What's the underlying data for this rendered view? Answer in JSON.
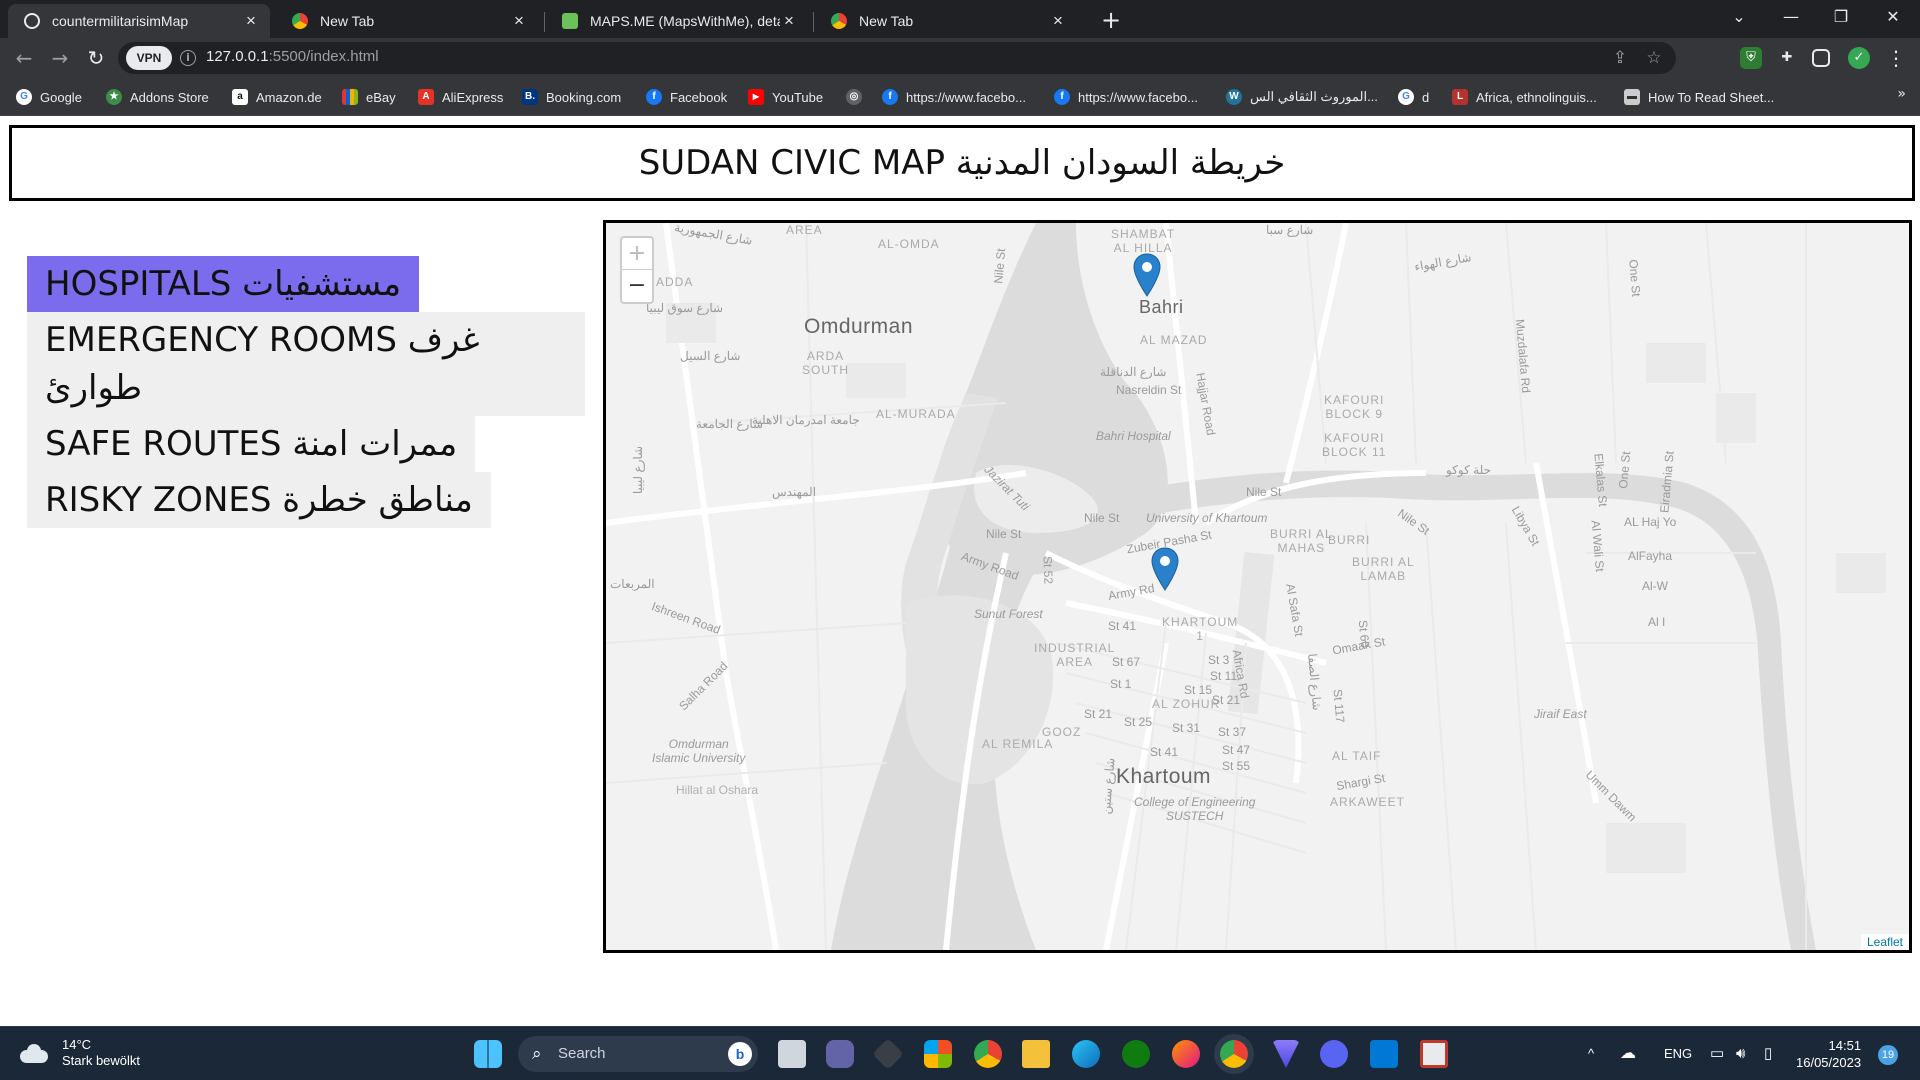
{
  "browser": {
    "tabs": [
      {
        "title": "countermilitarisimMap",
        "icon": "globe-icon",
        "color": "#e8eaed"
      },
      {
        "title": "New Tab",
        "icon": "chrome-icon",
        "color": "#4285f4"
      },
      {
        "title": "MAPS.ME (MapsWithMe), detailed",
        "icon": "mapsme-icon",
        "color": "#6ac259"
      },
      {
        "title": "New Tab",
        "icon": "chrome-icon",
        "color": "#4285f4"
      }
    ],
    "new_tab_label": "+",
    "vpn_label": "VPN",
    "url_host": "127.0.0.1",
    "url_path": ":5500/index.html",
    "bookmarks": [
      {
        "label": "Google",
        "icon": "google-icon",
        "color": "#4285f4",
        "glyph": "G"
      },
      {
        "label": "Addons Store",
        "icon": "addons-icon",
        "color": "#3c8c4a",
        "glyph": "★"
      },
      {
        "label": "Amazon.de",
        "icon": "amazon-icon",
        "color": "#111111",
        "glyph": "a"
      },
      {
        "label": "eBay",
        "icon": "ebay-icon",
        "color": "#e53238",
        "glyph": "e"
      },
      {
        "label": "AliExpress",
        "icon": "aliexpress-icon",
        "color": "#e43225",
        "glyph": "A"
      },
      {
        "label": "Booking.com",
        "icon": "booking-icon",
        "color": "#003580",
        "glyph": "B."
      },
      {
        "label": "Facebook",
        "icon": "facebook-icon",
        "color": "#1877f2",
        "glyph": "f"
      },
      {
        "label": "YouTube",
        "icon": "youtube-icon",
        "color": "#ff0000",
        "glyph": "▶"
      },
      {
        "label": "",
        "icon": "globe-icon",
        "color": "#5f6368",
        "glyph": "◎"
      },
      {
        "label": "https://www.facebo...",
        "icon": "facebook-icon",
        "color": "#1877f2",
        "glyph": "f"
      },
      {
        "label": "https://www.facebo...",
        "icon": "facebook-icon",
        "color": "#1877f2",
        "glyph": "f"
      },
      {
        "label": "الموروث الثقافي الس...",
        "icon": "wordpress-icon",
        "color": "#21759b",
        "glyph": "W"
      },
      {
        "label": "d",
        "icon": "google-icon",
        "color": "#4285f4",
        "glyph": "G"
      },
      {
        "label": "Africa, ethnolinguis...",
        "icon": "loc-icon",
        "color": "#b5332e",
        "glyph": "L"
      },
      {
        "label": "How To Read Sheet...",
        "icon": "sheet-icon",
        "color": "#cccccc",
        "glyph": "▬"
      }
    ],
    "more_label": "»"
  },
  "page": {
    "title": "SUDAN CIVIC MAP خريطة السودان المدنية",
    "categories": [
      {
        "label": "HOSPITALS مستشفيات",
        "active": true
      },
      {
        "label": "EMERGENCY ROOMS غرف طوارئ",
        "active": false
      },
      {
        "label": "SAFE ROUTES ممرات امنة",
        "active": false
      },
      {
        "label": "RISKY ZONES مناطق خطرة",
        "active": false
      }
    ],
    "active_color": "#7b6cee",
    "marker_color": "#2a81cb"
  },
  "map": {
    "zoom_in": "+",
    "zoom_out": "−",
    "attribution": "Leaflet",
    "labels": {
      "omdurman": "Omdurman",
      "bahri": "Bahri",
      "khartoum": "Khartoum",
      "area": "AREA",
      "al_omda": "AL-OMDA",
      "shambat": "SHAMBAT",
      "al_hilla": "AL HILLA",
      "adda": "ADDA",
      "arda": "ARDA",
      "south": "SOUTH",
      "al_mazad": "AL MAZAD",
      "al_murada": "AL-MURADA",
      "kafouri9a": "KAFOURI",
      "kafouri9b": "BLOCK 9",
      "kafouri11a": "KAFOURI",
      "kafouri11b": "BLOCK 11",
      "burri_mahas_a": "BURRI AL",
      "burri_mahas_b": "MAHAS",
      "burri": "BURRI",
      "burri_lamab_a": "BURRI AL",
      "burri_lamab_b": "LAMAB",
      "khartoum1_a": "KHARTOUM",
      "khartoum1_b": "1",
      "industrial_a": "INDUSTRIAL",
      "industrial_b": "AREA",
      "al_zohur": "AL ZOHUR",
      "al_remila": "AL REMILA",
      "gooz": "GOOZ",
      "al_taif": "AL TAIF",
      "arkaweet": "ARKAWEET",
      "nasreldin": "Nasreldin St",
      "bahri_hospital": "Bahri Hospital",
      "hajjar": "Hajjar Road",
      "muzdalafa": "Muzdalafa Rd",
      "nile1": "Nile St",
      "nile2": "Nile St",
      "nile3": "Nile St",
      "nile4": "Nile St",
      "nile5": "Nile St",
      "jazirat": "Jazirat Tuti",
      "uofk": "University of Khartoum",
      "zubeir": "Zubeir Pasha St",
      "army1": "Army Road",
      "army2": "Army Rd",
      "st52": "St 52",
      "sunut": "Sunut Forest",
      "ishreen": "Ishreen Road",
      "salha": "Salha Road",
      "omdurman_islamic_a": "Omdurman",
      "omdurman_islamic_b": "Islamic University",
      "hillat": "Hillat al Oshara",
      "college_a": "College of Engineering",
      "college_b": "SUSTECH",
      "st41a": "St 41",
      "st67": "St 67",
      "st1": "St 1",
      "st3": "St 3",
      "st11": "St 11",
      "st15": "St 15",
      "st21a": "St 21",
      "st21b": "St 21",
      "st25": "St 25",
      "st31": "St 31",
      "st37": "St 37",
      "st41b": "St 41",
      "st47": "St 47",
      "st55": "St 55",
      "africa": "Africa Rd",
      "alsafa": "Al Safa St",
      "st60": "St 60",
      "st117": "St 117",
      "omaak": "Omaak St",
      "shargi": "Shargi St",
      "libya": "Libya St",
      "elkalas": "Elkalas St",
      "alwali": "Al Wali St",
      "onest1": "One St",
      "onest2": "One St",
      "eiradmia": "Eiradmia St",
      "alhaj": "AL Haj Yo",
      "alfayha": "AlFayha",
      "alw": "Al-W",
      "ali": "Al I",
      "jiraif": "Jiraif East",
      "umm": "Umm Dawm",
      "ar_jamhuriya": "شارع الجمهورية",
      "ar_souq_libya": "شارع سوق ليبيا",
      "ar_seyl": "شارع السيل",
      "ar_jamea": "شارع الجامعة",
      "ar_ahlia": "جامعة امدرمان الاهلية",
      "ar_mohandis": "المهندس",
      "ar_mrabaat": "المربعات",
      "ar_libya_v": "شارع ليبيا",
      "ar_dannaqla": "شارع الدناقلة",
      "ar_saba": "شارع سبا",
      "ar_hawa": "شارع الهواء",
      "ar_koko": "حلة كوكو",
      "ar_safa": "شارع الصفا",
      "ar_sitteen": "شارع ستين"
    }
  },
  "taskbar": {
    "temperature": "14°C",
    "weather": "Stark bewölkt",
    "search": "Search",
    "language": "ENG",
    "time": "14:51",
    "date": "16/05/2023",
    "notifications": "19",
    "tray_chevron": "^"
  }
}
